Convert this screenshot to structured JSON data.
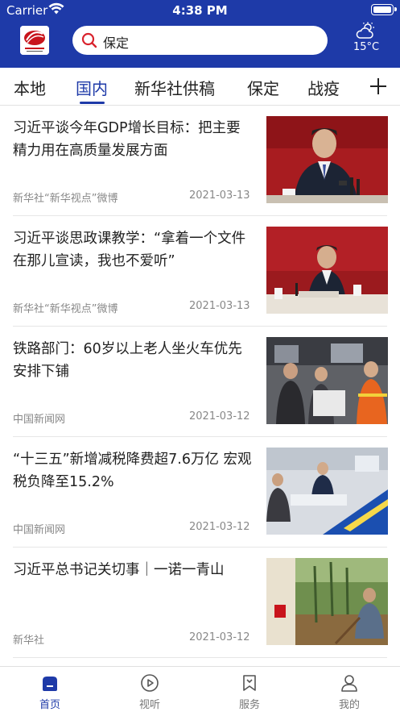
{
  "status_bar": {
    "carrier": "Carrier",
    "time": "4:38 PM"
  },
  "header": {
    "logo_alt": "app-logo",
    "search_text": "保定",
    "weather": {
      "icon": "partly-cloudy-icon",
      "temperature": "15°C"
    }
  },
  "tabs": [
    {
      "label": "本地",
      "active": false
    },
    {
      "label": "国内",
      "active": true
    },
    {
      "label": "新华社供稿",
      "active": false
    },
    {
      "label": "保定",
      "active": false
    },
    {
      "label": "战疫",
      "active": false
    }
  ],
  "colors": {
    "brand": "#1e3aa8",
    "muted_text": "#888888"
  },
  "news": [
    {
      "title": "习近平谈今年GDP增长目标：把主要精力用在高质量发展方面",
      "source": "新华社“新华视点”微博",
      "date": "2021-03-13"
    },
    {
      "title": "习近平谈思政课教学：“拿着一个文件在那儿宣读，我也不爱听”",
      "source": "新华社“新华视点”微博",
      "date": "2021-03-13"
    },
    {
      "title": "铁路部门：60岁以上老人坐火车优先安排下铺",
      "source": "中国新闻网",
      "date": "2021-03-12"
    },
    {
      "title": "“十三五”新增减税降费超7.6万亿 宏观税负降至15.2%",
      "source": "中国新闻网",
      "date": "2021-03-12"
    },
    {
      "title": "习近平总书记关切事｜一诺一青山",
      "source": "新华社",
      "date": "2021-03-12"
    }
  ],
  "bottom_tabs": [
    {
      "label": "首页",
      "icon": "home-icon",
      "active": true
    },
    {
      "label": "视听",
      "icon": "play-icon",
      "active": false
    },
    {
      "label": "服务",
      "icon": "bookmark-icon",
      "active": false
    },
    {
      "label": "我的",
      "icon": "profile-icon",
      "active": false
    }
  ]
}
